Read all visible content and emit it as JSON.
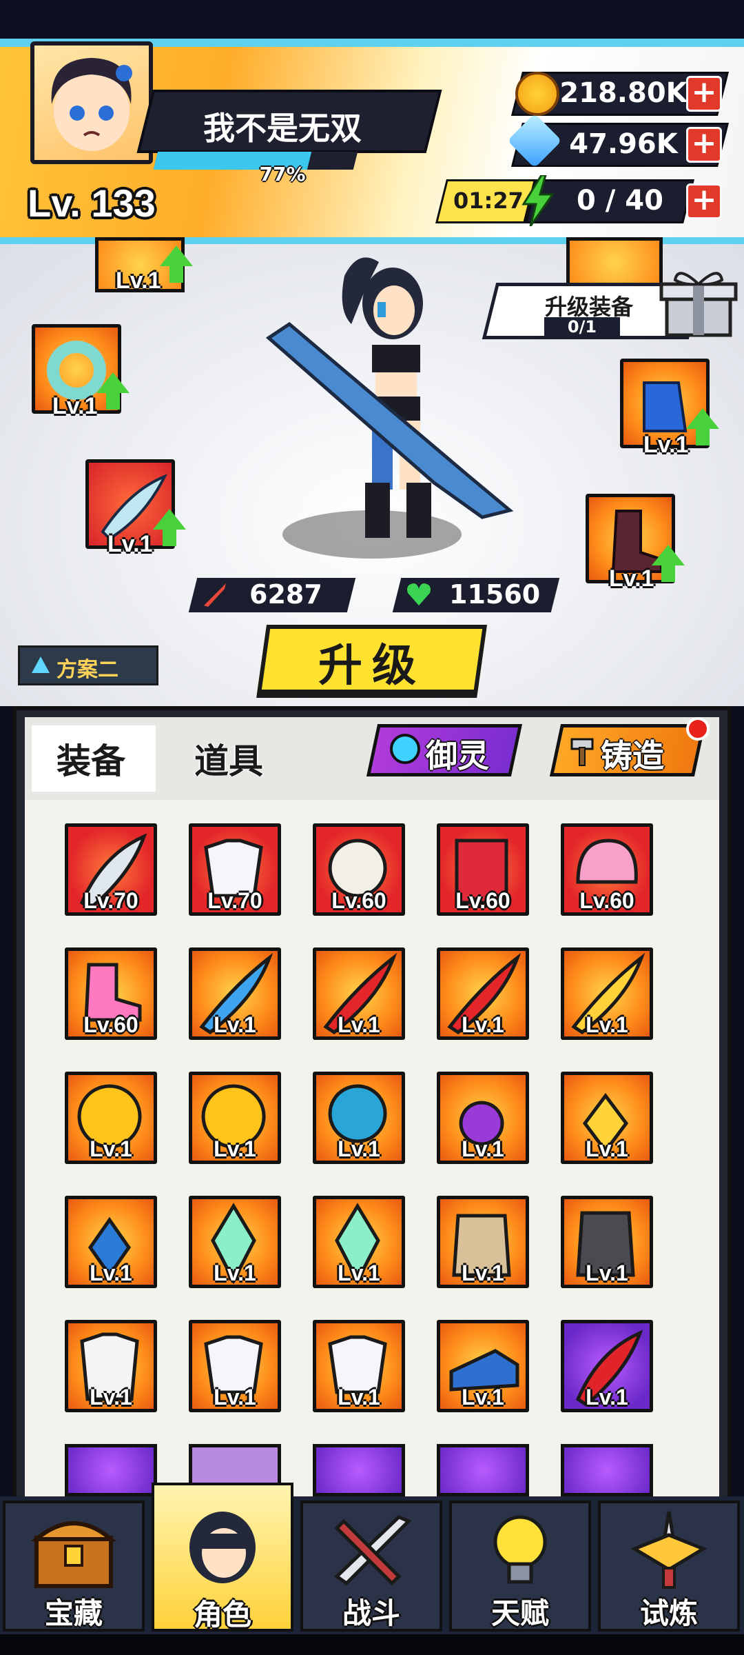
{
  "header": {
    "player_name": "我不是无双",
    "level": "Lv. 133",
    "exp_percent_text": "77%",
    "exp_fraction": 0.77,
    "gold": "218.80K",
    "gems": "47.96K",
    "energy_timer": "01:27",
    "energy": "0 / 40"
  },
  "stage": {
    "upgrade_gear_label": "升级装备",
    "upgrade_gear_count": "0/1",
    "equipped_slots": [
      {
        "name": "necklace",
        "level": "Lv.1"
      },
      {
        "name": "ring",
        "level": "Lv.1"
      },
      {
        "name": "weapon",
        "level": "Lv.1"
      },
      {
        "name": "armor",
        "level": ""
      },
      {
        "name": "gloves",
        "level": "Lv.1"
      },
      {
        "name": "boots",
        "level": "Lv.1"
      }
    ],
    "attack": "6287",
    "hp": "11560",
    "upgrade_button": "升级",
    "plan_label": "方案二"
  },
  "panel": {
    "tab_equipment": "装备",
    "tab_items": "道具",
    "spirit_button": "御灵",
    "forge_button": "铸造",
    "items": [
      {
        "name": "blade",
        "level": "Lv.70",
        "bg": "red"
      },
      {
        "name": "sailor-shirt",
        "level": "Lv.70",
        "bg": "red"
      },
      {
        "name": "ring",
        "level": "Lv.60",
        "bg": "red"
      },
      {
        "name": "book",
        "level": "Lv.60",
        "bg": "red"
      },
      {
        "name": "helmet",
        "level": "Lv.60",
        "bg": "red"
      },
      {
        "name": "roller-skate",
        "level": "Lv.60",
        "bg": "orange"
      },
      {
        "name": "ice-sword",
        "level": "Lv.1",
        "bg": "orange"
      },
      {
        "name": "red-sword",
        "level": "Lv.1",
        "bg": "orange"
      },
      {
        "name": "red-sword",
        "level": "Lv.1",
        "bg": "orange"
      },
      {
        "name": "yellow-sword",
        "level": "Lv.1",
        "bg": "orange"
      },
      {
        "name": "gold-ring",
        "level": "Lv.1",
        "bg": "orange"
      },
      {
        "name": "gold-ring",
        "level": "Lv.1",
        "bg": "orange"
      },
      {
        "name": "bead-necklace",
        "level": "Lv.1",
        "bg": "orange"
      },
      {
        "name": "purple-pendant",
        "level": "Lv.1",
        "bg": "orange"
      },
      {
        "name": "gold-pendant",
        "level": "Lv.1",
        "bg": "orange"
      },
      {
        "name": "blue-pendant",
        "level": "Lv.1",
        "bg": "orange"
      },
      {
        "name": "crystal",
        "level": "Lv.1",
        "bg": "orange"
      },
      {
        "name": "crystal",
        "level": "Lv.1",
        "bg": "orange"
      },
      {
        "name": "backpack",
        "level": "Lv.1",
        "bg": "orange"
      },
      {
        "name": "vest",
        "level": "Lv.1",
        "bg": "orange"
      },
      {
        "name": "karate-gi",
        "level": "Lv.1",
        "bg": "orange"
      },
      {
        "name": "sailor-shirt",
        "level": "Lv.1",
        "bg": "orange"
      },
      {
        "name": "sailor-shirt",
        "level": "Lv.1",
        "bg": "orange"
      },
      {
        "name": "blue-shoe",
        "level": "Lv.1",
        "bg": "orange"
      },
      {
        "name": "red-blade",
        "level": "Lv.1",
        "bg": "purple"
      }
    ]
  },
  "nav": [
    {
      "label": "宝藏",
      "icon": "treasure-chest-icon"
    },
    {
      "label": "角色",
      "icon": "character-icon"
    },
    {
      "label": "战斗",
      "icon": "battle-swords-icon"
    },
    {
      "label": "天赋",
      "icon": "lightbulb-icon"
    },
    {
      "label": "试炼",
      "icon": "trial-sword-icon"
    }
  ],
  "colors": {
    "accent_cyan": "#5fd0ee",
    "upgrade_yellow": "#ffe130",
    "plus_red": "#e23a2a",
    "energy_green": "#49d13b"
  }
}
